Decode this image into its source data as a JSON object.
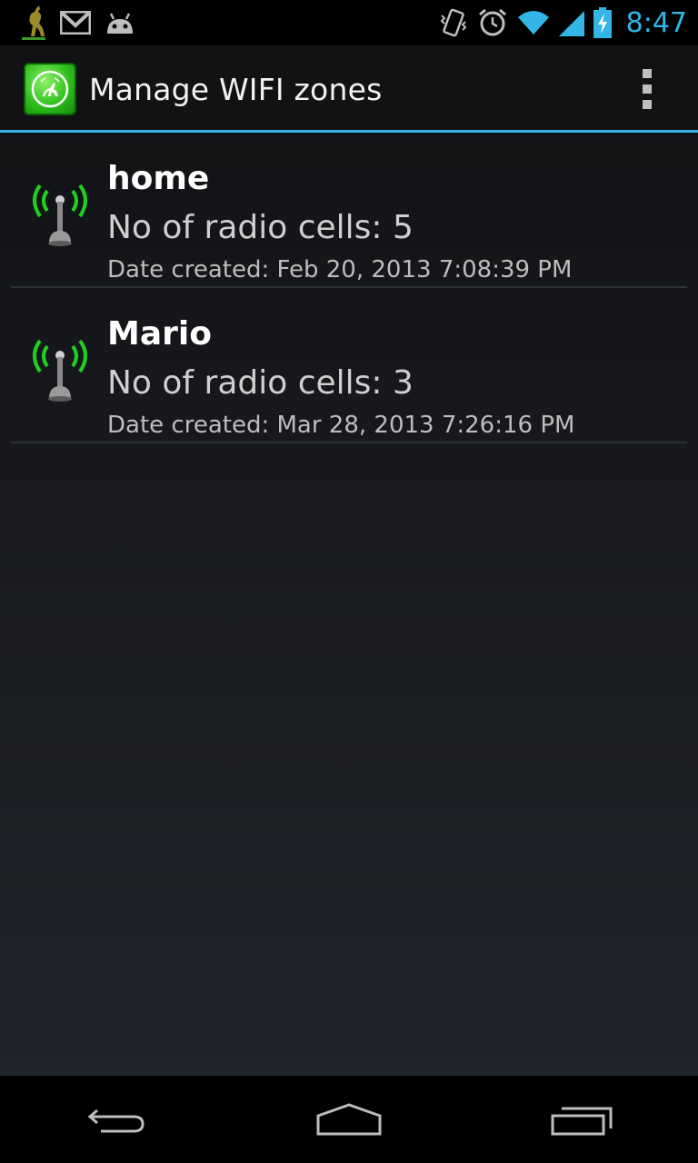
{
  "status_bar": {
    "time": "8:47",
    "left_icons": [
      "kangaroo-notification-icon",
      "gmail-icon",
      "android-debug-icon"
    ],
    "right_icons": [
      "vibrate-icon",
      "alarm-icon",
      "wifi-icon",
      "signal-icon",
      "battery-charging-icon"
    ],
    "accent_color": "#33b5e5"
  },
  "action_bar": {
    "title": "Manage WIFI zones",
    "app_icon": "app-logo-icon",
    "overflow_icon": "overflow-menu-icon"
  },
  "zones": [
    {
      "name": "home",
      "cells": "No of radio cells: 5",
      "date": "Date created: Feb 20, 2013 7:08:39 PM",
      "icon": "radio-tower-icon"
    },
    {
      "name": "Mario",
      "cells": "No of radio cells: 3",
      "date": "Date created: Mar 28, 2013 7:26:16 PM",
      "icon": "radio-tower-icon"
    }
  ],
  "nav_bar": {
    "buttons": [
      "back-icon",
      "home-icon",
      "recent-apps-icon"
    ]
  }
}
